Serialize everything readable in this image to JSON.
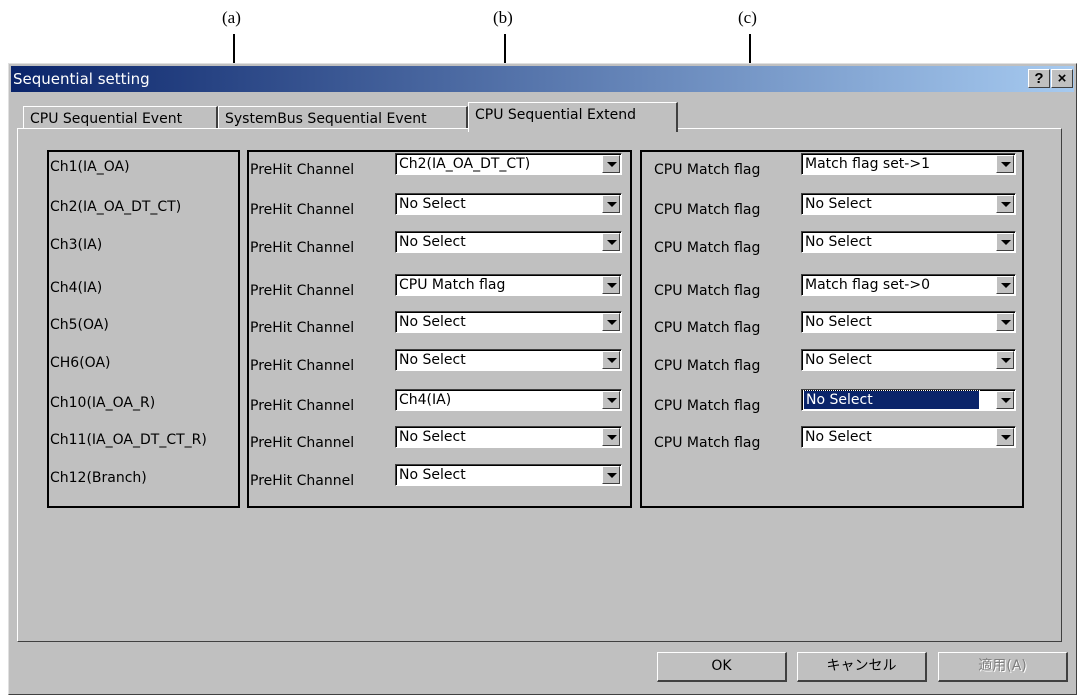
{
  "callouts": {
    "a": "(a)",
    "b": "(b)",
    "c": "(c)"
  },
  "window": {
    "title": "Sequential setting",
    "help_label": "?",
    "close_label": "×"
  },
  "tabs": [
    {
      "label": "CPU Sequential Event"
    },
    {
      "label": "SystemBus Sequential Event"
    },
    {
      "label": "CPU Sequential Extend"
    }
  ],
  "channels": [
    {
      "name": "Ch1(IA_OA)",
      "prehit_label": "PreHit Channel",
      "prehit_value": "Ch2(IA_OA_DT_CT)",
      "match_label": "CPU Match flag",
      "match_value": "Match flag set->1"
    },
    {
      "name": "Ch2(IA_OA_DT_CT)",
      "prehit_label": "PreHit Channel",
      "prehit_value": "No Select",
      "match_label": "CPU Match flag",
      "match_value": "No Select"
    },
    {
      "name": "Ch3(IA)",
      "prehit_label": "PreHit Channel",
      "prehit_value": "No Select",
      "match_label": "CPU Match flag",
      "match_value": "No Select"
    },
    {
      "name": "Ch4(IA)",
      "prehit_label": "PreHit Channel",
      "prehit_value": "CPU Match flag",
      "match_label": "CPU Match flag",
      "match_value": "Match flag set->0"
    },
    {
      "name": "Ch5(OA)",
      "prehit_label": "PreHit Channel",
      "prehit_value": "No Select",
      "match_label": "CPU Match flag",
      "match_value": "No Select"
    },
    {
      "name": "CH6(OA)",
      "prehit_label": "PreHit Channel",
      "prehit_value": "No Select",
      "match_label": "CPU Match flag",
      "match_value": "No Select"
    },
    {
      "name": "Ch10(IA_OA_R)",
      "prehit_label": "PreHit Channel",
      "prehit_value": "Ch4(IA)",
      "match_label": "CPU Match flag",
      "match_value": "No Select"
    },
    {
      "name": "Ch11(IA_OA_DT_CT_R)",
      "prehit_label": "PreHit Channel",
      "prehit_value": "No Select",
      "match_label": "CPU Match flag",
      "match_value": "No Select"
    },
    {
      "name": "Ch12(Branch)",
      "prehit_label": "PreHit Channel",
      "prehit_value": "No Select"
    }
  ],
  "buttons": {
    "ok": "OK",
    "cancel": "キャンセル",
    "apply": "適用(A)"
  }
}
